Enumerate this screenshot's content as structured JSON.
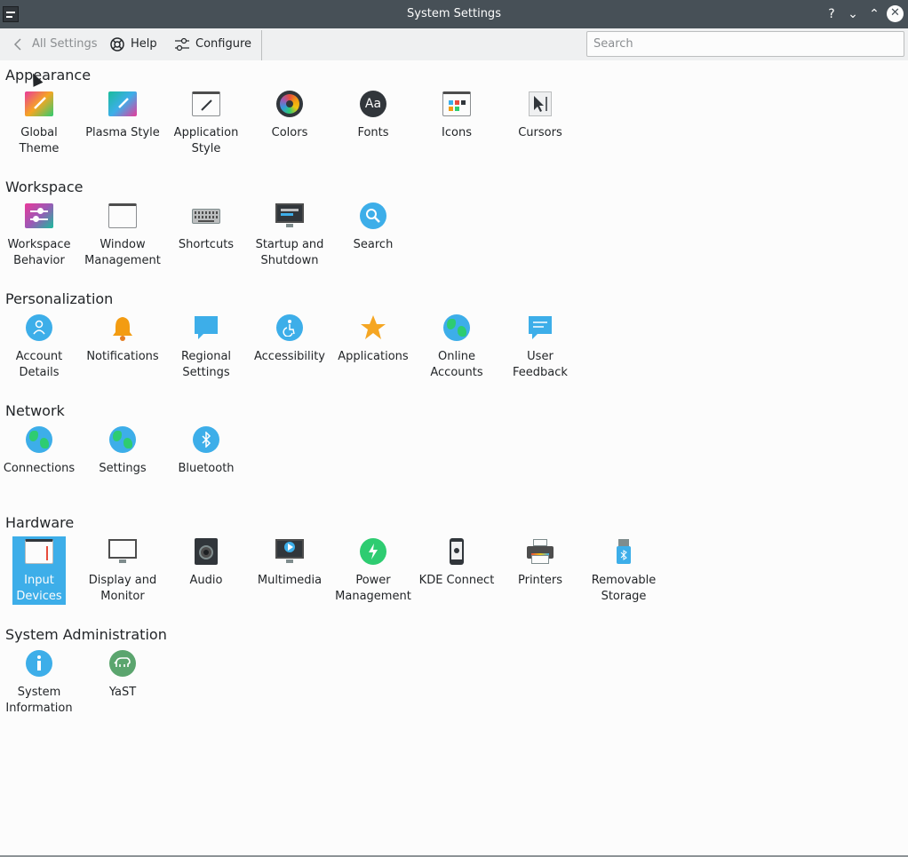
{
  "window": {
    "title": "System Settings",
    "help_btn": "?",
    "minimize_btn": "⌄",
    "maximize_btn": "⌃",
    "close_btn": "✕"
  },
  "toolbar": {
    "back_label": "All Settings",
    "help_label": "Help",
    "configure_label": "Configure",
    "search_placeholder": "Search"
  },
  "sections": {
    "appearance": {
      "title": "Appearance",
      "items": [
        {
          "label": "Global\nTheme",
          "icon": "global-theme-icon"
        },
        {
          "label": "Plasma Style",
          "icon": "plasma-style-icon"
        },
        {
          "label": "Application\nStyle",
          "icon": "application-style-icon"
        },
        {
          "label": "Colors",
          "icon": "colors-icon"
        },
        {
          "label": "Fonts",
          "icon": "fonts-icon",
          "glyph": "Aa"
        },
        {
          "label": "Icons",
          "icon": "icons-icon"
        },
        {
          "label": "Cursors",
          "icon": "cursors-icon"
        }
      ]
    },
    "workspace": {
      "title": "Workspace",
      "items": [
        {
          "label": "Workspace\nBehavior",
          "icon": "workspace-behavior-icon"
        },
        {
          "label": "Window\nManagement",
          "icon": "window-management-icon"
        },
        {
          "label": "Shortcuts",
          "icon": "shortcuts-icon"
        },
        {
          "label": "Startup and\nShutdown",
          "icon": "startup-shutdown-icon"
        },
        {
          "label": "Search",
          "icon": "search-icon"
        }
      ]
    },
    "personalization": {
      "title": "Personalization",
      "items": [
        {
          "label": "Account\nDetails",
          "icon": "account-details-icon"
        },
        {
          "label": "Notifications",
          "icon": "notifications-icon"
        },
        {
          "label": "Regional\nSettings",
          "icon": "regional-settings-icon"
        },
        {
          "label": "Accessibility",
          "icon": "accessibility-icon"
        },
        {
          "label": "Applications",
          "icon": "applications-icon"
        },
        {
          "label": "Online\nAccounts",
          "icon": "online-accounts-icon"
        },
        {
          "label": "User\nFeedback",
          "icon": "user-feedback-icon"
        }
      ]
    },
    "network": {
      "title": "Network",
      "items": [
        {
          "label": "Connections",
          "icon": "connections-icon"
        },
        {
          "label": "Settings",
          "icon": "network-settings-icon"
        },
        {
          "label": "Bluetooth",
          "icon": "bluetooth-icon"
        }
      ]
    },
    "hardware": {
      "title": "Hardware",
      "items": [
        {
          "label": "Input\nDevices",
          "icon": "input-devices-icon",
          "selected": true
        },
        {
          "label": "Display and\nMonitor",
          "icon": "display-monitor-icon"
        },
        {
          "label": "Audio",
          "icon": "audio-icon"
        },
        {
          "label": "Multimedia",
          "icon": "multimedia-icon"
        },
        {
          "label": "Power\nManagement",
          "icon": "power-management-icon"
        },
        {
          "label": "KDE Connect",
          "icon": "kde-connect-icon"
        },
        {
          "label": "Printers",
          "icon": "printers-icon"
        },
        {
          "label": "Removable\nStorage",
          "icon": "removable-storage-icon"
        }
      ]
    },
    "sysadmin": {
      "title": "System Administration",
      "items": [
        {
          "label": "System\nInformation",
          "icon": "system-information-icon"
        },
        {
          "label": "YaST",
          "icon": "yast-icon"
        }
      ]
    }
  },
  "colors": {
    "accent": "#3daee9",
    "titlebar": "#475057",
    "background": "#fcfcfc"
  }
}
